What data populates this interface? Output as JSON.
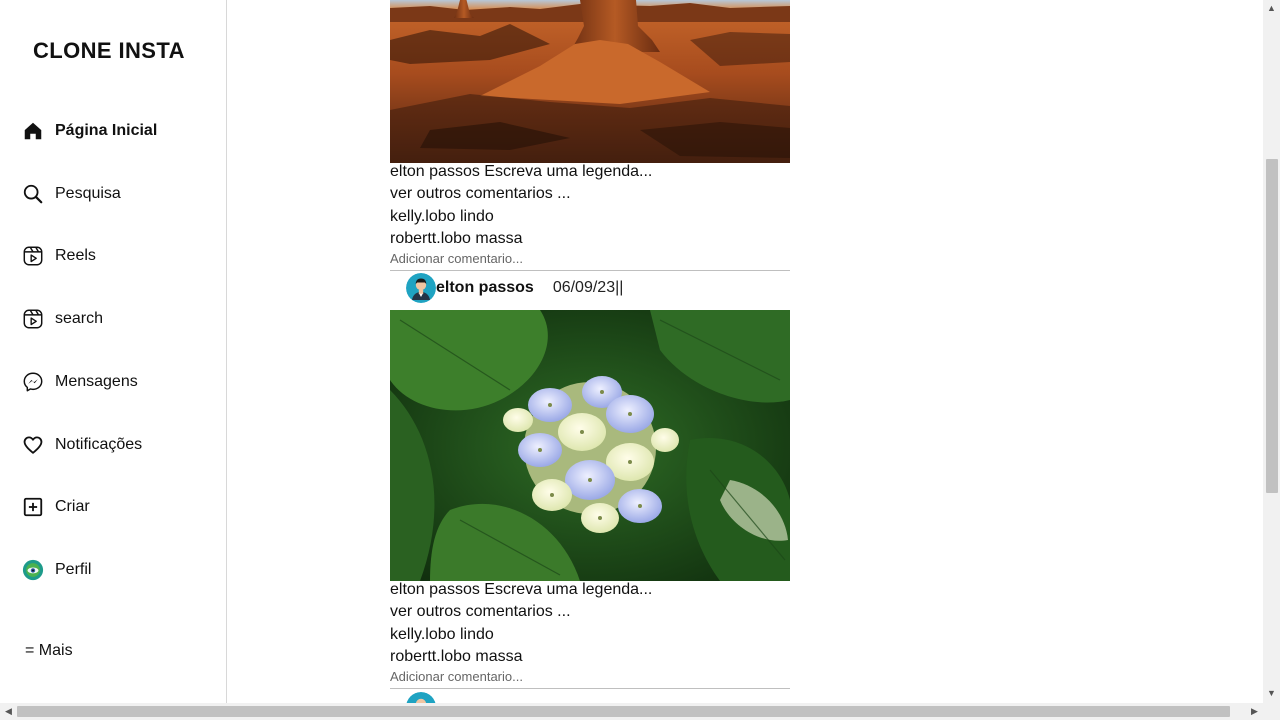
{
  "app": {
    "title": "CLONE INSTA"
  },
  "sidebar": {
    "items": [
      {
        "label": "Página Inicial",
        "icon": "home-icon",
        "active": true
      },
      {
        "label": "Pesquisa",
        "icon": "search-icon"
      },
      {
        "label": "Reels",
        "icon": "reels-icon"
      },
      {
        "label": "search",
        "icon": "reels-icon"
      },
      {
        "label": "Mensagens",
        "icon": "messenger-icon"
      },
      {
        "label": "Notificações",
        "icon": "heart-icon"
      },
      {
        "label": "Criar",
        "icon": "plus-square-icon"
      },
      {
        "label": "Perfil",
        "icon": "profile-avatar-icon"
      }
    ],
    "more_label": "= Mais"
  },
  "posts": [
    {
      "caption": "elton passos Escreva uma legenda...",
      "view_comments": "ver outros comentarios ...",
      "comments": [
        "kelly.lobo lindo",
        "robertt.lobo massa"
      ],
      "add_comment_placeholder": "Adicionar comentario...",
      "image_subject": "desert-buttes"
    },
    {
      "username": "elton passos",
      "date": "06/09/23||",
      "caption": "elton passos Escreva uma legenda...",
      "view_comments": "ver outros comentarios ...",
      "comments": [
        "kelly.lobo lindo",
        "robertt.lobo massa"
      ],
      "add_comment_placeholder": "Adicionar comentario...",
      "image_subject": "hydrangea-flower"
    }
  ],
  "colors": {
    "sidebar_border": "#d8d8d8",
    "avatar_teal": "#1fa3c2",
    "scrollbar_track": "#f1f1f1",
    "scrollbar_thumb": "#c1c1c1"
  }
}
